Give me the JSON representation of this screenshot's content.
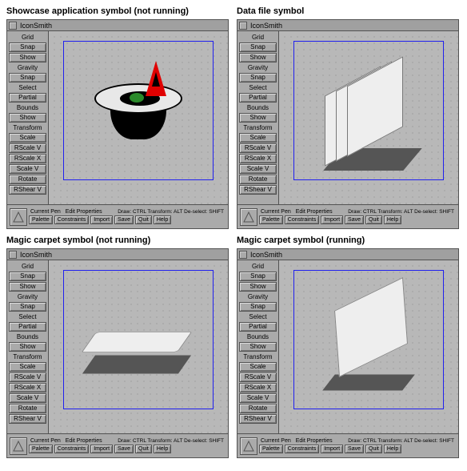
{
  "panels": [
    {
      "caption": "Showcase application symbol (not running)",
      "title": "IconSmith",
      "artKind": "hat"
    },
    {
      "caption": "Data file symbol",
      "title": "IconSmith",
      "artKind": "sheets"
    },
    {
      "caption": "Magic carpet symbol (not running)",
      "title": "IconSmith",
      "artKind": "carpet_flat"
    },
    {
      "caption": "Magic carpet symbol (running)",
      "title": "IconSmith",
      "artKind": "carpet_fly"
    }
  ],
  "side": {
    "sections": [
      {
        "label": "Grid",
        "buttons": [
          "Snap",
          "Show"
        ]
      },
      {
        "label": "Gravity",
        "buttons": [
          "Snap"
        ]
      },
      {
        "label": "Select",
        "buttons": [
          "Partial"
        ]
      },
      {
        "label": "Bounds",
        "buttons": [
          "Show"
        ]
      },
      {
        "label": "Transform",
        "buttons": [
          "Scale",
          "RScale V",
          "RScale X",
          "Scale V",
          "Rotate",
          "RShear V"
        ]
      }
    ]
  },
  "bottom": {
    "currentPenLabel": "Current Pen",
    "editPropsLabel": "Edit Properties",
    "hints": "Draw: CTRL  Transform: ALT  De-select: SHIFT",
    "buttons": [
      "Palette",
      "Constraints",
      "Import",
      "Save",
      "Quit",
      "Help"
    ]
  }
}
